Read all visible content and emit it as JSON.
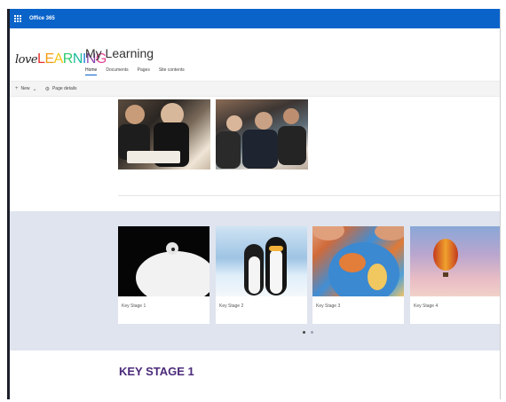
{
  "suite": {
    "title": "Office 365"
  },
  "site": {
    "logo": {
      "love": "love",
      "letters": [
        "L",
        "E",
        "A",
        "R",
        "N",
        "I",
        "N",
        "G"
      ]
    },
    "title": "My Learning",
    "nav": [
      "Home",
      "Documents",
      "Pages",
      "Site contents"
    ],
    "active_nav": "Home"
  },
  "commands": {
    "new_label": "New",
    "page_details_label": "Page details"
  },
  "key_stages": [
    {
      "label": "Key Stage 1",
      "image": "swan-photo"
    },
    {
      "label": "Key Stage 2",
      "image": "penguins-photo"
    },
    {
      "label": "Key Stage 3",
      "image": "globe-photo"
    },
    {
      "label": "Key Stage 4",
      "image": "hot-air-balloon-photo"
    }
  ],
  "carousel": {
    "pages": 2,
    "current": 1
  },
  "section_heading": "KEY STAGE 1",
  "colors": {
    "suite_bar": "#0a63c9",
    "band": "#dfe4ee",
    "heading": "#4b2a7a"
  }
}
